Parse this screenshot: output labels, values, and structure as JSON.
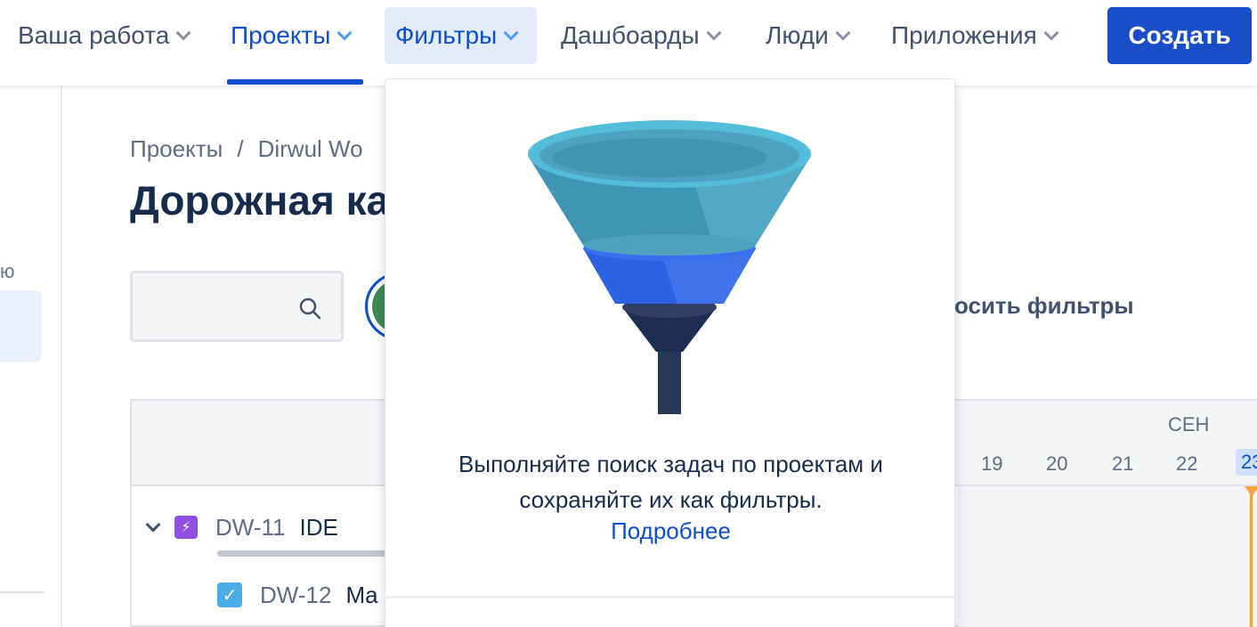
{
  "nav": {
    "items": [
      {
        "label": "Ваша работа"
      },
      {
        "label": "Проекты"
      },
      {
        "label": "Фильтры"
      },
      {
        "label": "Дашбоарды"
      },
      {
        "label": "Люди"
      },
      {
        "label": "Приложения"
      }
    ],
    "create_label": "Создать"
  },
  "sidebar": {
    "partial_label": "ю"
  },
  "breadcrumb": {
    "root": "Проекты",
    "separator": "/",
    "project": "Dirwul Wo"
  },
  "page": {
    "title": "Дорожная ка"
  },
  "filters": {
    "reset_label": "бросить фильтры"
  },
  "timeline": {
    "month": "СЕН",
    "days": [
      "19",
      "20",
      "21",
      "22",
      "23"
    ],
    "today": "23"
  },
  "issues": [
    {
      "key": "DW-11",
      "summary": "IDE",
      "type": "epic-icon"
    },
    {
      "key": "DW-12",
      "summary": "Ma",
      "type": "task-icon"
    }
  ],
  "dropdown": {
    "description_line1": "Выполняйте поиск задач по проектам и",
    "description_line2": "сохраняйте их как фильтры.",
    "learn_more": "Подробнее"
  }
}
